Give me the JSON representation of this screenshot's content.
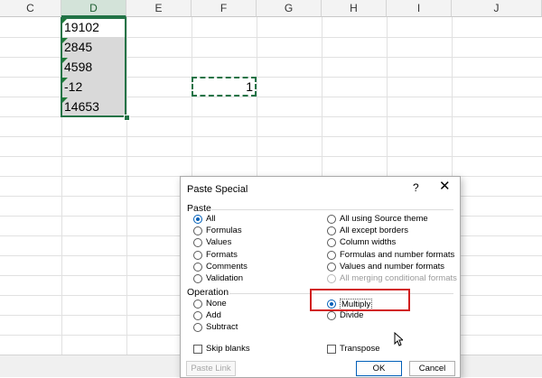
{
  "sheet": {
    "columns": [
      "C",
      "D",
      "E",
      "F",
      "G",
      "H",
      "I",
      "J"
    ],
    "selected_column": "D",
    "cells_d": [
      "19102",
      "2845",
      "4598",
      "-12",
      "14653"
    ],
    "cell_f4": "1"
  },
  "dialog": {
    "title": "Paste Special",
    "help": "?",
    "close": "✕",
    "paste_group": "Paste",
    "paste_left": [
      "All",
      "Formulas",
      "Values",
      "Formats",
      "Comments",
      "Validation"
    ],
    "paste_right": [
      "All using Source theme",
      "All except borders",
      "Column widths",
      "Formulas and number formats",
      "Values and number formats",
      "All merging conditional formats"
    ],
    "operation_group": "Operation",
    "operation_left": [
      "None",
      "Add",
      "Subtract"
    ],
    "operation_right": [
      "Multiply",
      "Divide"
    ],
    "skip_blanks": "Skip blanks",
    "transpose": "Transpose",
    "paste_link": "Paste Link",
    "ok": "OK",
    "cancel": "Cancel",
    "selected_paste": "All",
    "selected_operation": "Multiply"
  },
  "colors": {
    "accent_green": "#217346",
    "highlight_red": "#d11f1f"
  }
}
